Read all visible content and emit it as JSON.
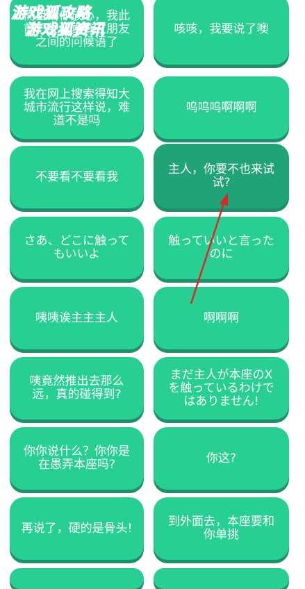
{
  "colors": {
    "button_bg": "#27cf93",
    "button_highlight_bg": "#1fa377",
    "button_shadow": "#1e8f6d",
    "text": "#ffffff",
    "arrow": "#e02424",
    "watermark": "#3cafe6"
  },
  "watermark": {
    "line1": "游戏狐攻略",
    "line2": "游戏狐资讯"
  },
  "buttons": [
    {
      "label": "而且请你放心，我此前已经认真查过朋友之间的问候语了"
    },
    {
      "label": "咳咳，我要说了噢"
    },
    {
      "label": "我在网上搜索得知大城市流行这样说，难道不是吗"
    },
    {
      "label": "呜呜呜啊啊啊"
    },
    {
      "label": "不要看不要看我"
    },
    {
      "label": "主人，你要不也来试试?"
    },
    {
      "label": "さあ、どこに触ってもいいよ"
    },
    {
      "label": "触っていいと言ったのに"
    },
    {
      "label": "咦咦诶主主主人"
    },
    {
      "label": "啊啊啊"
    },
    {
      "label": "咦竟然推出去那么远，真的碰得到?"
    },
    {
      "label": "まだ主人が本座のXを触っているわけではありません!"
    },
    {
      "label": "你你说什么？你你是在愚弄本座吗?"
    },
    {
      "label": "你这?"
    },
    {
      "label": "再说了，硬的是骨头!"
    },
    {
      "label": "到外面去，本座要和你单挑"
    }
  ]
}
